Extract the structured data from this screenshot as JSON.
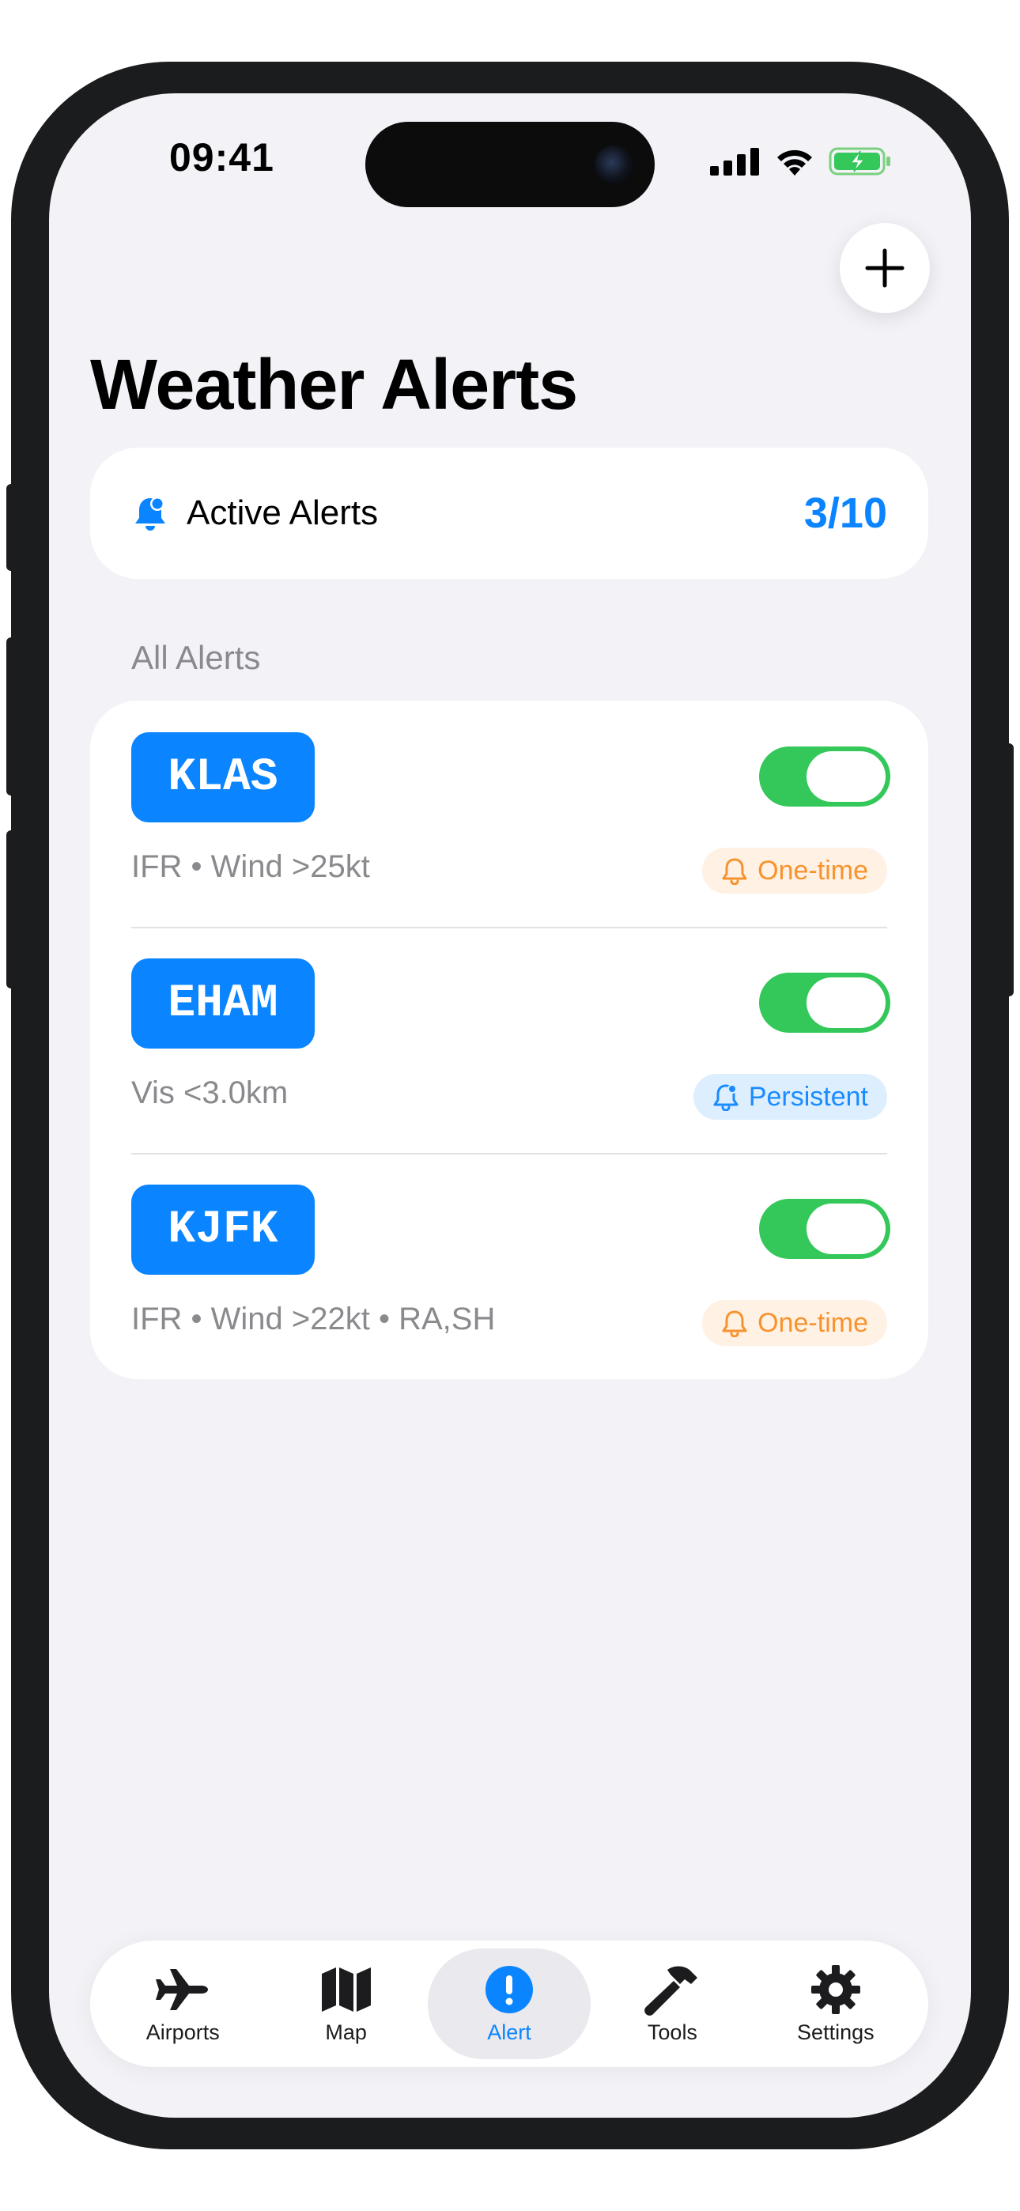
{
  "status_bar": {
    "time": "09:41"
  },
  "header": {
    "title": "Weather Alerts",
    "add_icon": "plus-icon"
  },
  "summary": {
    "icon": "bell-badge-icon",
    "label": "Active Alerts",
    "count": "3/10"
  },
  "section": {
    "title": "All Alerts"
  },
  "alerts": [
    {
      "code": "KLAS",
      "detail": "IFR • Wind >25kt",
      "enabled": true,
      "mode": "One-time",
      "mode_type": "one-time"
    },
    {
      "code": "EHAM",
      "detail": "Vis <3.0km",
      "enabled": true,
      "mode": "Persistent",
      "mode_type": "persistent"
    },
    {
      "code": "KJFK",
      "detail": "IFR • Wind >22kt • RA,SH",
      "enabled": true,
      "mode": "One-time",
      "mode_type": "one-time"
    }
  ],
  "tab_bar": {
    "tabs": [
      {
        "label": "Airports",
        "icon": "airplane-icon",
        "active": false
      },
      {
        "label": "Map",
        "icon": "map-icon",
        "active": false
      },
      {
        "label": "Alert",
        "icon": "alert-icon",
        "active": true
      },
      {
        "label": "Tools",
        "icon": "hammer-icon",
        "active": false
      },
      {
        "label": "Settings",
        "icon": "gear-icon",
        "active": false
      }
    ]
  },
  "colors": {
    "accent": "#0a84ff",
    "toggle_on": "#34c759",
    "one_time": "#f7932f",
    "persistent": "#1a8cff"
  }
}
